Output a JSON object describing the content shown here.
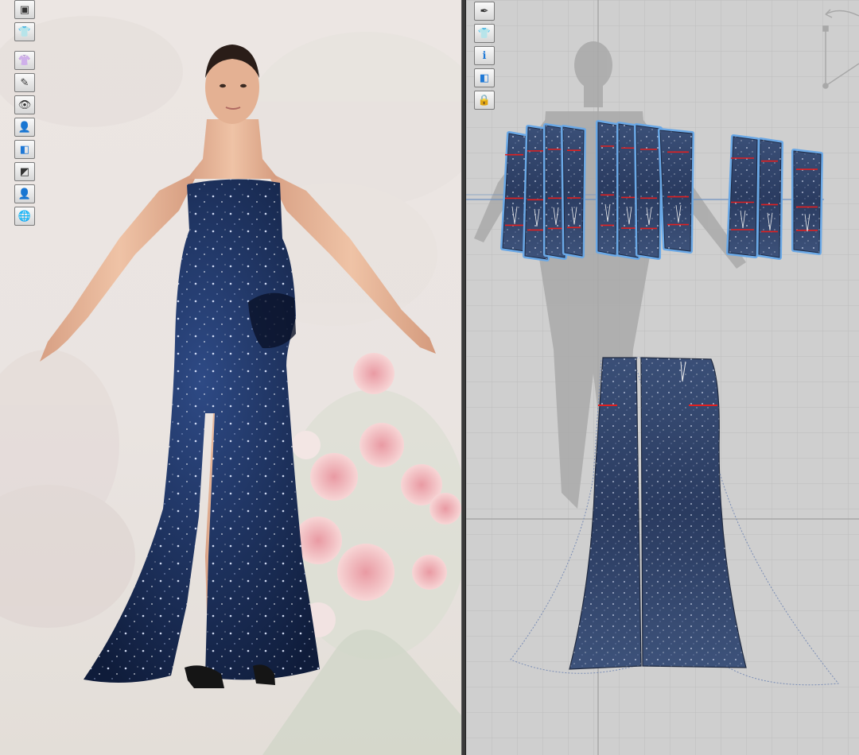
{
  "toolbar_3d": {
    "items": [
      {
        "id": "render",
        "icon": "box-render-icon",
        "glyph": "▣"
      },
      {
        "id": "garment",
        "icon": "tshirt-icon",
        "glyph": "👕"
      },
      {
        "id": "show-garment",
        "icon": "garment-view-icon",
        "glyph": "👚"
      },
      {
        "id": "brush",
        "icon": "brush-eye-icon",
        "glyph": "✎"
      },
      {
        "id": "visibility",
        "icon": "eye-icon",
        "glyph": "👁"
      },
      {
        "id": "avatar",
        "icon": "avatar-icon",
        "glyph": "👤"
      },
      {
        "id": "texture",
        "icon": "texture-view-icon",
        "glyph": "◧"
      },
      {
        "id": "solid",
        "icon": "solid-view-icon",
        "glyph": "◩"
      },
      {
        "id": "skin",
        "icon": "skin-avatar-icon",
        "glyph": "👤"
      },
      {
        "id": "globe",
        "icon": "globe-icon",
        "glyph": "🌐"
      }
    ]
  },
  "toolbar_2d": {
    "items": [
      {
        "id": "pen",
        "icon": "pen-icon",
        "glyph": "✒"
      },
      {
        "id": "garment",
        "icon": "tshirt-icon",
        "glyph": "👕"
      },
      {
        "id": "info",
        "icon": "info-icon",
        "glyph": "ℹ"
      },
      {
        "id": "texture",
        "icon": "texture-view-icon",
        "glyph": "◧"
      },
      {
        "id": "lock",
        "icon": "lock-icon",
        "glyph": "🔒"
      }
    ]
  },
  "colors": {
    "fabric": "#1d2f5c",
    "fabric_light": "#3b5282",
    "piece_outline": "#6aa8e6",
    "seam_red": "#e02020",
    "grid_bg": "#cfcfcf",
    "grid_line": "#bdbdbd",
    "avatar_shadow": "#a9a9a9",
    "skin": "#e8b89a"
  }
}
